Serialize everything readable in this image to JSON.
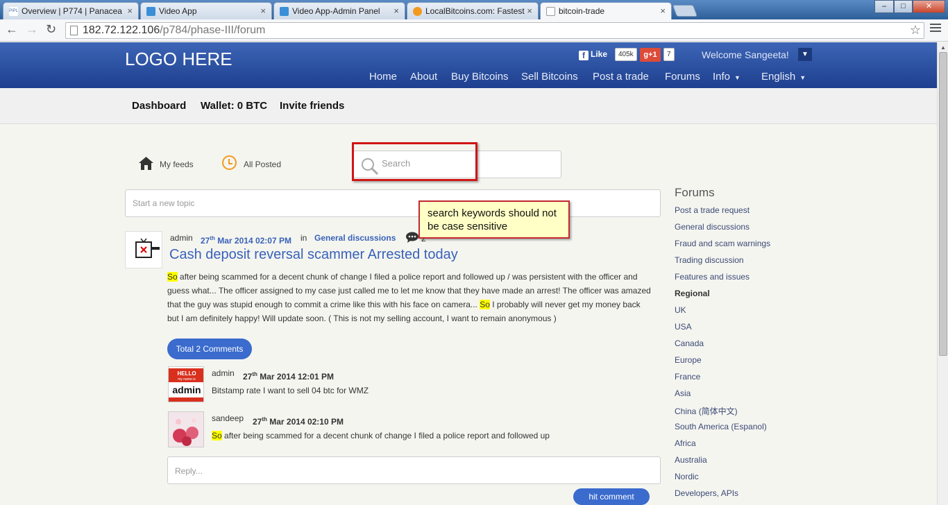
{
  "browser": {
    "tabs": [
      {
        "label": "Overview | P774 | Panacea",
        "favicon": "pipl-icon"
      },
      {
        "label": "Video App",
        "favicon": "video-app-icon"
      },
      {
        "label": "Video App-Admin Panel",
        "favicon": "video-app-icon"
      },
      {
        "label": "LocalBitcoins.com: Fastest",
        "favicon": "localbitcoins-icon"
      },
      {
        "label": "bitcoin-trade",
        "favicon": "page-icon"
      }
    ],
    "url_host": "182.72.122.106",
    "url_path": "/p784/phase-III/forum",
    "favicon_text": "PIPL"
  },
  "header": {
    "logo": "LOGO HERE",
    "fb_like": "Like",
    "fb_count": "405k",
    "gplus_label": "g+1",
    "gplus_count": "7",
    "welcome": "Welcome Sangeeta!",
    "nav": [
      "Home",
      "About",
      "Buy Bitcoins",
      "Sell Bitcoins",
      "Post a trade",
      "Forums",
      "Info",
      "English"
    ]
  },
  "subnav": {
    "dashboard": "Dashboard",
    "wallet": "Wallet: 0 BTC",
    "invite": "Invite friends"
  },
  "feed": {
    "my_feeds": "My feeds",
    "all_posted": "All Posted",
    "search_placeholder": "Search",
    "new_topic_placeholder": "Start a new topic"
  },
  "callout": "search keywords should not be case sensitive",
  "post": {
    "author": "admin",
    "date_day": "27",
    "date_suffix": "th",
    "date_rest": " Mar 2014 02:07 PM",
    "in_label": "in",
    "category": "General discussions",
    "comment_count": "2",
    "title": "Cash deposit reversal scammer Arrested today",
    "body_hl1": "So",
    "body_part1": " after being scammed for a decent chunk of change I filed a police report and followed up / was persistent with the officer and guess what... The officer assigned to my case just called me to let me know that they have made an arrest! The officer was amazed that the guy was stupid enough to commit a crime like this with his face on camera... ",
    "body_hl2": "So",
    "body_part2": " I probably will never get my money back but I am definitely happy! Will update soon. ( This is not my selling account, I want to remain anonymous )",
    "total_comments": "Total 2 Comments"
  },
  "comments": [
    {
      "author": "admin",
      "date_day": "27",
      "date_suffix": "th",
      "date_rest": " Mar 2014 12:01 PM",
      "text": "Bitstamp rate I want to sell 04 btc for WMZ",
      "badge_top": "HELLO",
      "badge_mid": "my name is",
      "badge_name": "admin"
    },
    {
      "author": "sandeep",
      "date_day": "27",
      "date_suffix": "th",
      "date_rest": " Mar 2014 02:10 PM",
      "text_hl": "So",
      "text": " after being scammed for a decent chunk of change I filed a police report and followed up"
    }
  ],
  "reply": {
    "placeholder": "Reply...",
    "button": "hit comment"
  },
  "sidebar": {
    "title": "Forums",
    "items": [
      {
        "label": "Post a trade request",
        "heading": false
      },
      {
        "label": "General discussions",
        "heading": false
      },
      {
        "label": "Fraud and scam warnings",
        "heading": false
      },
      {
        "label": "Trading discussion",
        "heading": false
      },
      {
        "label": "Features and issues",
        "heading": false
      },
      {
        "label": "Regional",
        "heading": true
      },
      {
        "label": "UK",
        "heading": false
      },
      {
        "label": "USA",
        "heading": false
      },
      {
        "label": "Canada",
        "heading": false
      },
      {
        "label": "Europe",
        "heading": false
      },
      {
        "label": "France",
        "heading": false
      },
      {
        "label": "Asia",
        "heading": false
      },
      {
        "label": "China (简体中文)",
        "heading": false
      },
      {
        "label": "South America (Espanol)",
        "heading": false
      },
      {
        "label": "Africa",
        "heading": false
      },
      {
        "label": "Australia",
        "heading": false
      },
      {
        "label": "Nordic",
        "heading": false
      },
      {
        "label": "Developers, APIs",
        "heading": false
      }
    ]
  },
  "colors": {
    "header_blue": "#2a4fa0",
    "link_blue": "#3862b8",
    "button_blue": "#3a6bcd",
    "highlight": "#ffff00",
    "callout_bg": "#ffffc6",
    "callout_border": "#c3282d"
  }
}
